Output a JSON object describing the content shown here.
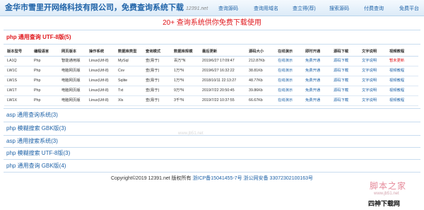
{
  "header": {
    "title": "金华市雪里开网络科技有限公司，免费查询系统下载",
    "domain": "12391.net",
    "nav": [
      "查询源码",
      "查询用域名",
      "查立得(荐)",
      "搜索源码",
      "付费查询",
      "免费平台"
    ]
  },
  "slogan": "20+ 查询系统供你免费下载使用",
  "active_section": {
    "title": "php 通用查询 UTF-8版(5)"
  },
  "table": {
    "columns": [
      "版本型号",
      "编程语言",
      "网页版本",
      "操作系统",
      "数据库类型",
      "查询模式",
      "数据库规模",
      "最后更新",
      "源码大小",
      "在线演示",
      "即时开通",
      "源码下载",
      "文字说明",
      "视频教程"
    ],
    "rows": [
      [
        "LA1Q",
        "Php",
        "智能通用版",
        "Linux(Utf-8)",
        "MySql",
        "查(易于)",
        "百万*N",
        "2019/6/27 17:09:47",
        "212.87Kb",
        "在线演示",
        "免费开通",
        "源码下载",
        "文字说明",
        "暂未更新"
      ],
      [
        "LW1C",
        "Php",
        "电脑网页版",
        "Linux(Utf-8)",
        "Csv",
        "查(易于)",
        "1万*N",
        "2019/6/27 16:32:22",
        "38.81Kb",
        "在线演示",
        "免费开通",
        "源码下载",
        "文字说明",
        "视频教程"
      ],
      [
        "LW1S",
        "Php",
        "电脑网页版",
        "Linux(Utf-8)",
        "Sqlite",
        "查(易于)",
        "1万*N",
        "2018/10/11 22:13:27",
        "48.77Kb",
        "在线演示",
        "免费开通",
        "源码下载",
        "文字说明",
        "视频教程"
      ],
      [
        "LW1T",
        "Php",
        "电脑网页版",
        "Linux(Utf-8)",
        "Txt",
        "查(易于)",
        "9万*N",
        "2019/7/22 20:50:45",
        "39.86Kb",
        "在线演示",
        "免费开通",
        "源码下载",
        "文字说明",
        "视频教程"
      ],
      [
        "LW1X",
        "Php",
        "电脑网页版",
        "Linux(Utf-8)",
        "Xls",
        "查(易于)",
        "3千*N",
        "2019/7/22 10:37:55",
        "66.67Kb",
        "在线演示",
        "免费开通",
        "源码下载",
        "文字说明",
        "视频教程"
      ]
    ]
  },
  "sections": [
    "asp 通用查询系统(3)",
    "php 模糊搜索 GBK版(3)",
    "asp 通用搜索系统(3)",
    "php 模糊搜索 UTF-8版(3)",
    "php 通用查询 GBK版(4)"
  ],
  "footer": {
    "copyright": "Copyright©2019 12391.net 版权所有",
    "icp": "浙ICP备15041455-7号 浙公网安备 33072302100163号"
  },
  "watermarks": {
    "center": "www.jb51.net",
    "brand": "脚本之家",
    "brand_url": "www.jb51.net",
    "corner": "四神下载网"
  }
}
